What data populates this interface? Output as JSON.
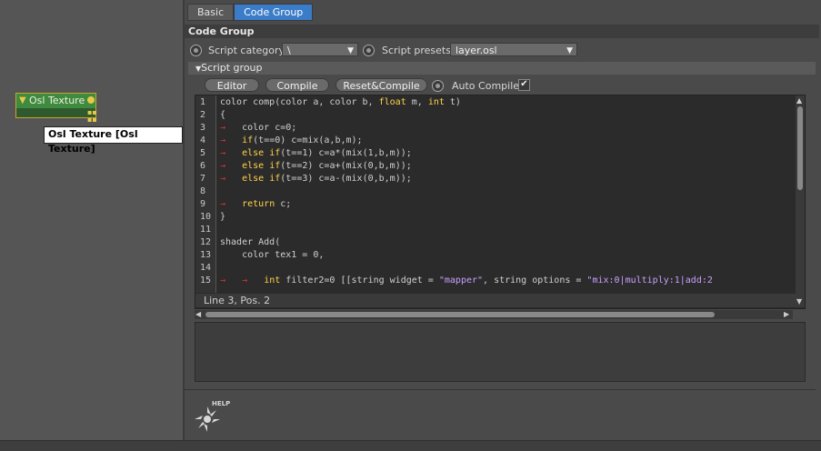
{
  "node": {
    "title": "Osl Texture",
    "tooltip": "Osl Texture [Osl Texture]"
  },
  "tabs": [
    {
      "label": "Basic"
    },
    {
      "label": "Code Group"
    }
  ],
  "section_title": "Code Group",
  "script_category": {
    "label": "Script category",
    "value": "\\"
  },
  "script_presets": {
    "label": "Script presets",
    "value": "layer.osl"
  },
  "script_group": {
    "label": "Script group"
  },
  "buttons": {
    "editor": "Editor",
    "compile": "Compile",
    "reset_compile": "Reset&Compile",
    "auto_compile": "Auto Compile",
    "auto_compile_checked": true
  },
  "code_lines": [
    {
      "n": "1",
      "text": "color comp(color a, color b, float m, int t)"
    },
    {
      "n": "2",
      "text": "{"
    },
    {
      "n": "3",
      "text": "→   color c=0;"
    },
    {
      "n": "4",
      "text": "→   if(t==0) c=mix(a,b,m);"
    },
    {
      "n": "5",
      "text": "→   else if(t==1) c=a*(mix(1,b,m));"
    },
    {
      "n": "6",
      "text": "→   else if(t==2) c=a+(mix(0,b,m));"
    },
    {
      "n": "7",
      "text": "→   else if(t==3) c=a-(mix(0,b,m));"
    },
    {
      "n": "8",
      "text": ""
    },
    {
      "n": "9",
      "text": "→   return c;"
    },
    {
      "n": "10",
      "text": "}"
    },
    {
      "n": "11",
      "text": ""
    },
    {
      "n": "12",
      "text": "shader Add("
    },
    {
      "n": "13",
      "text": "    color tex1 = 0,"
    },
    {
      "n": "14",
      "text": ""
    },
    {
      "n": "15",
      "text": "→   →   int filter2=0 [[string widget = \"mapper\", string options = \"mix:0|multiply:1|add:2"
    }
  ],
  "status": "Line 3, Pos. 2",
  "help_label": "HELP",
  "colors": {
    "accent": "#3b7cc8",
    "node_header": "#3e8a3e",
    "node_border": "#c9a42a",
    "keyword": "#ffd34a",
    "tab_marker": "#e03030",
    "string": "#c8a0ff"
  }
}
